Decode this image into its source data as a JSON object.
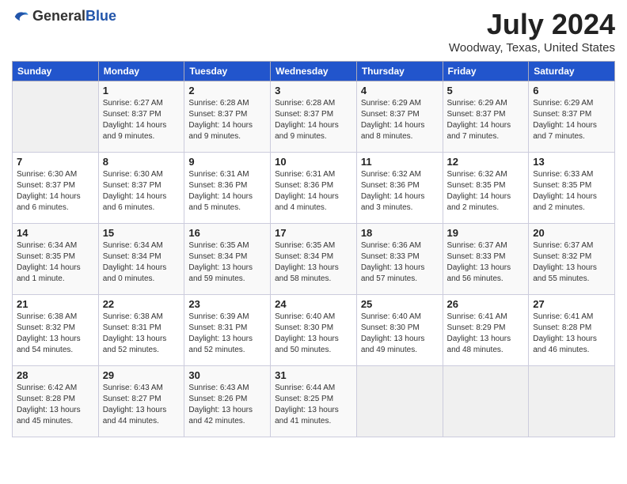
{
  "header": {
    "logo_general": "General",
    "logo_blue": "Blue",
    "month_title": "July 2024",
    "location": "Woodway, Texas, United States"
  },
  "days_of_week": [
    "Sunday",
    "Monday",
    "Tuesday",
    "Wednesday",
    "Thursday",
    "Friday",
    "Saturday"
  ],
  "weeks": [
    [
      {
        "day": "",
        "info": ""
      },
      {
        "day": "1",
        "info": "Sunrise: 6:27 AM\nSunset: 8:37 PM\nDaylight: 14 hours\nand 9 minutes."
      },
      {
        "day": "2",
        "info": "Sunrise: 6:28 AM\nSunset: 8:37 PM\nDaylight: 14 hours\nand 9 minutes."
      },
      {
        "day": "3",
        "info": "Sunrise: 6:28 AM\nSunset: 8:37 PM\nDaylight: 14 hours\nand 9 minutes."
      },
      {
        "day": "4",
        "info": "Sunrise: 6:29 AM\nSunset: 8:37 PM\nDaylight: 14 hours\nand 8 minutes."
      },
      {
        "day": "5",
        "info": "Sunrise: 6:29 AM\nSunset: 8:37 PM\nDaylight: 14 hours\nand 7 minutes."
      },
      {
        "day": "6",
        "info": "Sunrise: 6:29 AM\nSunset: 8:37 PM\nDaylight: 14 hours\nand 7 minutes."
      }
    ],
    [
      {
        "day": "7",
        "info": "Sunrise: 6:30 AM\nSunset: 8:37 PM\nDaylight: 14 hours\nand 6 minutes."
      },
      {
        "day": "8",
        "info": "Sunrise: 6:30 AM\nSunset: 8:37 PM\nDaylight: 14 hours\nand 6 minutes."
      },
      {
        "day": "9",
        "info": "Sunrise: 6:31 AM\nSunset: 8:36 PM\nDaylight: 14 hours\nand 5 minutes."
      },
      {
        "day": "10",
        "info": "Sunrise: 6:31 AM\nSunset: 8:36 PM\nDaylight: 14 hours\nand 4 minutes."
      },
      {
        "day": "11",
        "info": "Sunrise: 6:32 AM\nSunset: 8:36 PM\nDaylight: 14 hours\nand 3 minutes."
      },
      {
        "day": "12",
        "info": "Sunrise: 6:32 AM\nSunset: 8:35 PM\nDaylight: 14 hours\nand 2 minutes."
      },
      {
        "day": "13",
        "info": "Sunrise: 6:33 AM\nSunset: 8:35 PM\nDaylight: 14 hours\nand 2 minutes."
      }
    ],
    [
      {
        "day": "14",
        "info": "Sunrise: 6:34 AM\nSunset: 8:35 PM\nDaylight: 14 hours\nand 1 minute."
      },
      {
        "day": "15",
        "info": "Sunrise: 6:34 AM\nSunset: 8:34 PM\nDaylight: 14 hours\nand 0 minutes."
      },
      {
        "day": "16",
        "info": "Sunrise: 6:35 AM\nSunset: 8:34 PM\nDaylight: 13 hours\nand 59 minutes."
      },
      {
        "day": "17",
        "info": "Sunrise: 6:35 AM\nSunset: 8:34 PM\nDaylight: 13 hours\nand 58 minutes."
      },
      {
        "day": "18",
        "info": "Sunrise: 6:36 AM\nSunset: 8:33 PM\nDaylight: 13 hours\nand 57 minutes."
      },
      {
        "day": "19",
        "info": "Sunrise: 6:37 AM\nSunset: 8:33 PM\nDaylight: 13 hours\nand 56 minutes."
      },
      {
        "day": "20",
        "info": "Sunrise: 6:37 AM\nSunset: 8:32 PM\nDaylight: 13 hours\nand 55 minutes."
      }
    ],
    [
      {
        "day": "21",
        "info": "Sunrise: 6:38 AM\nSunset: 8:32 PM\nDaylight: 13 hours\nand 54 minutes."
      },
      {
        "day": "22",
        "info": "Sunrise: 6:38 AM\nSunset: 8:31 PM\nDaylight: 13 hours\nand 52 minutes."
      },
      {
        "day": "23",
        "info": "Sunrise: 6:39 AM\nSunset: 8:31 PM\nDaylight: 13 hours\nand 52 minutes."
      },
      {
        "day": "24",
        "info": "Sunrise: 6:40 AM\nSunset: 8:30 PM\nDaylight: 13 hours\nand 50 minutes."
      },
      {
        "day": "25",
        "info": "Sunrise: 6:40 AM\nSunset: 8:30 PM\nDaylight: 13 hours\nand 49 minutes."
      },
      {
        "day": "26",
        "info": "Sunrise: 6:41 AM\nSunset: 8:29 PM\nDaylight: 13 hours\nand 48 minutes."
      },
      {
        "day": "27",
        "info": "Sunrise: 6:41 AM\nSunset: 8:28 PM\nDaylight: 13 hours\nand 46 minutes."
      }
    ],
    [
      {
        "day": "28",
        "info": "Sunrise: 6:42 AM\nSunset: 8:28 PM\nDaylight: 13 hours\nand 45 minutes."
      },
      {
        "day": "29",
        "info": "Sunrise: 6:43 AM\nSunset: 8:27 PM\nDaylight: 13 hours\nand 44 minutes."
      },
      {
        "day": "30",
        "info": "Sunrise: 6:43 AM\nSunset: 8:26 PM\nDaylight: 13 hours\nand 42 minutes."
      },
      {
        "day": "31",
        "info": "Sunrise: 6:44 AM\nSunset: 8:25 PM\nDaylight: 13 hours\nand 41 minutes."
      },
      {
        "day": "",
        "info": ""
      },
      {
        "day": "",
        "info": ""
      },
      {
        "day": "",
        "info": ""
      }
    ]
  ]
}
